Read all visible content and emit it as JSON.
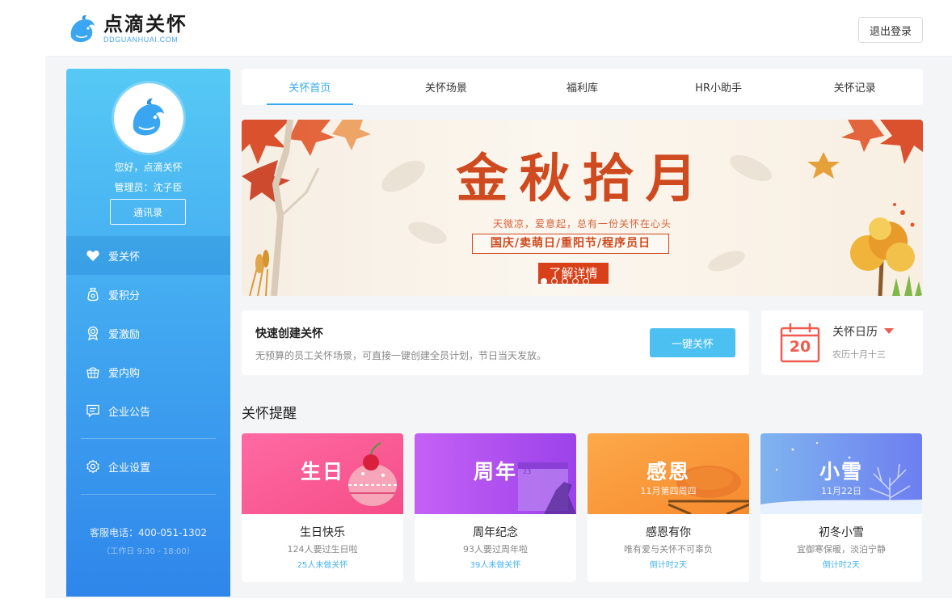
{
  "brand": {
    "name": "点滴关怀",
    "sub": "DDGUANHUAI.COM"
  },
  "header": {
    "logout_label": "退出登录"
  },
  "sidebar": {
    "greeting": "您好，点滴关怀",
    "admin": "管理员：沈子臣",
    "contacts_label": "通讯录",
    "items": [
      {
        "label": "爱关怀",
        "icon": "heart-icon"
      },
      {
        "label": "爱积分",
        "icon": "points-bag-icon"
      },
      {
        "label": "爱激励",
        "icon": "medal-icon"
      },
      {
        "label": "爱内购",
        "icon": "basket-icon"
      },
      {
        "label": "企业公告",
        "icon": "notice-icon"
      },
      {
        "label": "企业设置",
        "icon": "gear-icon"
      }
    ],
    "service_phone": "客服电话：400-051-1302",
    "service_hours": "（工作日 9:30 - 18:00）"
  },
  "tabs": [
    "关怀首页",
    "关怀场景",
    "福利库",
    "HR小助手",
    "关怀记录"
  ],
  "banner": {
    "title": "金秋拾月",
    "subtitle": "天微凉，爱意起，总有一份关怀在心头",
    "festivals": "国庆/卖萌日/重阳节/程序员日",
    "cta": "了解详情",
    "slides": 5,
    "active_slide": 0
  },
  "quick": {
    "title": "快速创建关怀",
    "desc": "无预算的员工关怀场景，可直接一键创建全员计划，节日当天发放。",
    "button": "一键关怀"
  },
  "calendar": {
    "title": "关怀日历",
    "day": "20",
    "lunar": "农历十月十三"
  },
  "reminders": {
    "title": "关怀提醒",
    "cards": [
      {
        "big": "生日",
        "date": "",
        "title": "生日快乐",
        "desc": "124人要过生日啦",
        "status": "25人未做关怀"
      },
      {
        "big": "周年",
        "date": "",
        "title": "周年纪念",
        "desc": "93人要过周年啦",
        "status": "39人未做关怀"
      },
      {
        "big": "感恩",
        "date": "11月第四周四",
        "title": "感恩有你",
        "desc": "唯有爱与关怀不可辜负",
        "status": "倒计时2天"
      },
      {
        "big": "小雪",
        "date": "11月22日",
        "title": "初冬小雪",
        "desc": "宜御寒保暖，淡泊宁静",
        "status": "倒计时2天"
      }
    ]
  },
  "colors": {
    "accent": "#36a9ef",
    "sidebar_top": "#56c9f5",
    "sidebar_bottom": "#2f86ea",
    "banner_red": "#cf4a1f",
    "calendar_red": "#ee5c4f"
  }
}
